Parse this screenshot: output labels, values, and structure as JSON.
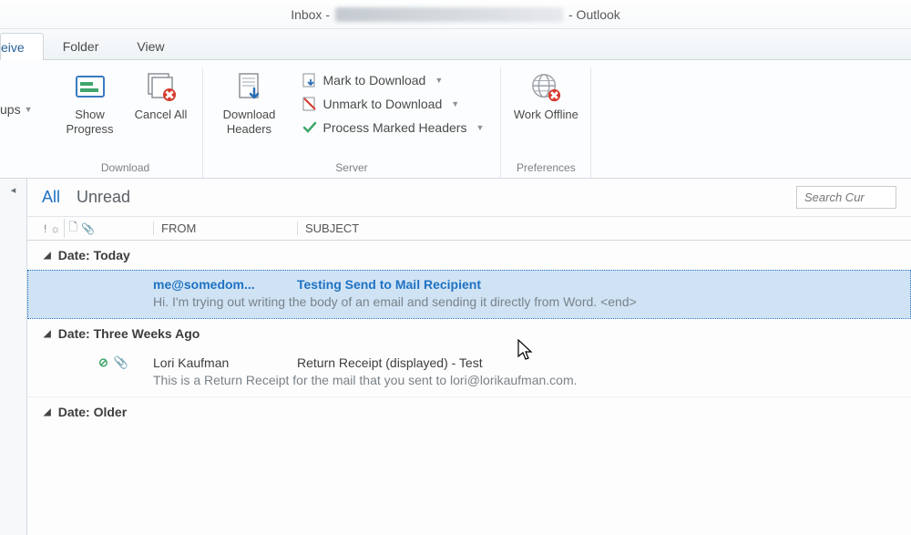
{
  "titlebar": {
    "prefix": "Inbox - ",
    "suffix": " - Outlook"
  },
  "tabs": {
    "partial": "eive",
    "folder": "Folder",
    "view": "View"
  },
  "ribbon": {
    "groups_stub": "ups",
    "show_progress": "Show Progress",
    "cancel_all": "Cancel All",
    "download_group": "Download",
    "download_headers": "Download Headers",
    "mark_download": "Mark to Download",
    "unmark_download": "Unmark to Download",
    "process_headers": "Process Marked Headers",
    "server_group": "Server",
    "work_offline": "Work Offline",
    "preferences_group": "Preferences"
  },
  "filter": {
    "all": "All",
    "unread": "Unread",
    "search_placeholder": "Search Cur"
  },
  "columns": {
    "from": "FROM",
    "subject": "SUBJECT"
  },
  "groups": {
    "today": "Date: Today",
    "three_weeks": "Date: Three Weeks Ago",
    "older": "Date: Older"
  },
  "mail1": {
    "from": "me@somedom...",
    "subject": "Testing Send to Mail Recipient",
    "preview": "Hi. I'm trying out writing the body of an email and sending it directly from Word. <end>"
  },
  "mail2": {
    "from": "Lori Kaufman",
    "subject": "Return Receipt (displayed) - Test",
    "preview": "This is a Return Receipt for the mail that you sent to lori@lorikaufman.com."
  }
}
